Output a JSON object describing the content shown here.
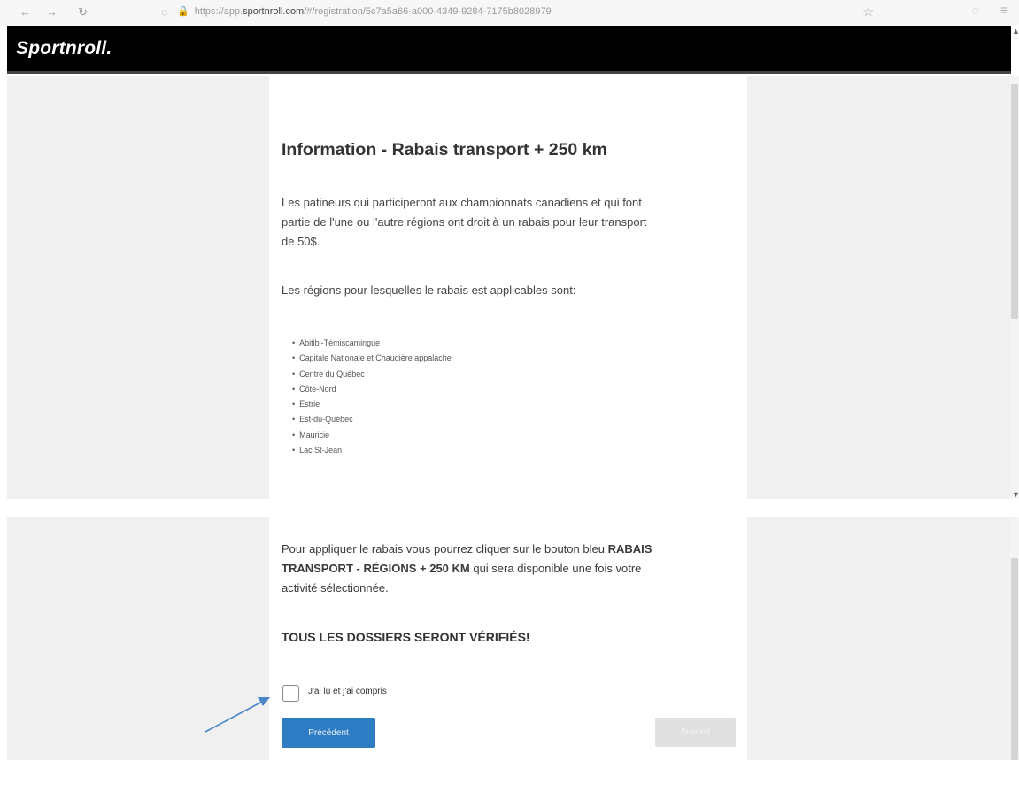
{
  "browser": {
    "back_icon": "←",
    "forward_icon": "→",
    "reload_icon": "↻",
    "shield_icon": "◌",
    "lock_icon": "🔒",
    "url_prefix": "https://app.",
    "url_host": "sportnroll.com",
    "url_path": "/#/registration/5c7a5a66-a000-4349-9284-7175b8028979",
    "star_icon": "☆",
    "extension_icon": "◌",
    "menu_icon": "≡"
  },
  "header": {
    "logo": "Sportnroll."
  },
  "content": {
    "title": "Information - Rabais transport + 250 km",
    "intro_line1": "Les patineurs qui participeront aux championnats canadiens et qui font",
    "intro_line2": "partie de l'une ou l'autre régions ont droit à un rabais pour leur transport",
    "intro_line3": "de 50$.",
    "regions_intro": "Les régions pour lesquelles le rabais est applicables sont:",
    "regions": [
      "Abitibi-Témiscamingue",
      "Capitale Nationale et Chaudière appalache",
      "Centre du Québec",
      "Côte-Nord",
      "Estrie",
      "Est-du-Québec",
      "Mauricie",
      "Lac St-Jean"
    ],
    "apply_line1_a": "Pour appliquer le rabais vous pourrez cliquer sur le bouton bleu ",
    "apply_line1_b": "RABAIS",
    "apply_line2_a": "TRANSPORT - RÉGIONS + 250 KM",
    "apply_line2_b": " qui sera disponible une fois votre",
    "apply_line3": "activité sélectionnée.",
    "verify_notice": "TOUS LES DOSSIERS SERONT VÉRIFIÉS!",
    "checkbox_label": "J'ai lu et j'ai compris"
  },
  "buttons": {
    "previous": "Précédent",
    "next": "Suivant"
  },
  "colors": {
    "header_bg": "#000000",
    "primary_button": "#2e7cc4",
    "disabled_button": "#e0e0e0",
    "annotation_arrow": "#4a86c8"
  }
}
